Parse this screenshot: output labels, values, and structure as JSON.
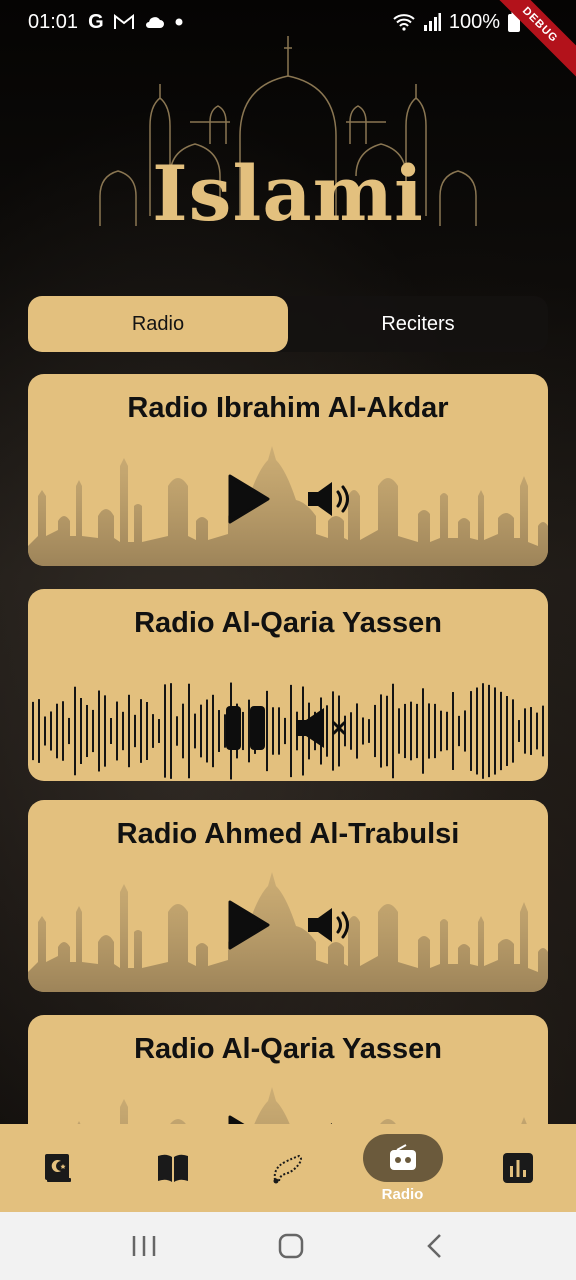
{
  "status_bar": {
    "time": "01:01",
    "battery": "100%",
    "debug": "DEBUG"
  },
  "app": {
    "logo_text": "Islami",
    "accent_color": "#e3c07e",
    "dark_color": "#141414"
  },
  "tabs": [
    {
      "label": "Radio",
      "active": true
    },
    {
      "label": "Reciters",
      "active": false
    }
  ],
  "stations": [
    {
      "name": "Radio Ibrahim Al-Akdar",
      "state": "stopped"
    },
    {
      "name": "Radio Al-Qaria Yassen",
      "state": "playing-muted"
    },
    {
      "name": "Radio Ahmed Al-Trabulsi",
      "state": "stopped"
    },
    {
      "name": "Radio Al-Qaria Yassen",
      "state": "stopped"
    }
  ],
  "bottom_nav": {
    "items": [
      {
        "icon": "quran-icon"
      },
      {
        "icon": "book-icon"
      },
      {
        "icon": "sebha-icon"
      },
      {
        "icon": "radio-icon",
        "label": "Radio",
        "active": true
      },
      {
        "icon": "stats-icon"
      }
    ]
  },
  "system_nav": [
    "recents",
    "home",
    "back"
  ]
}
